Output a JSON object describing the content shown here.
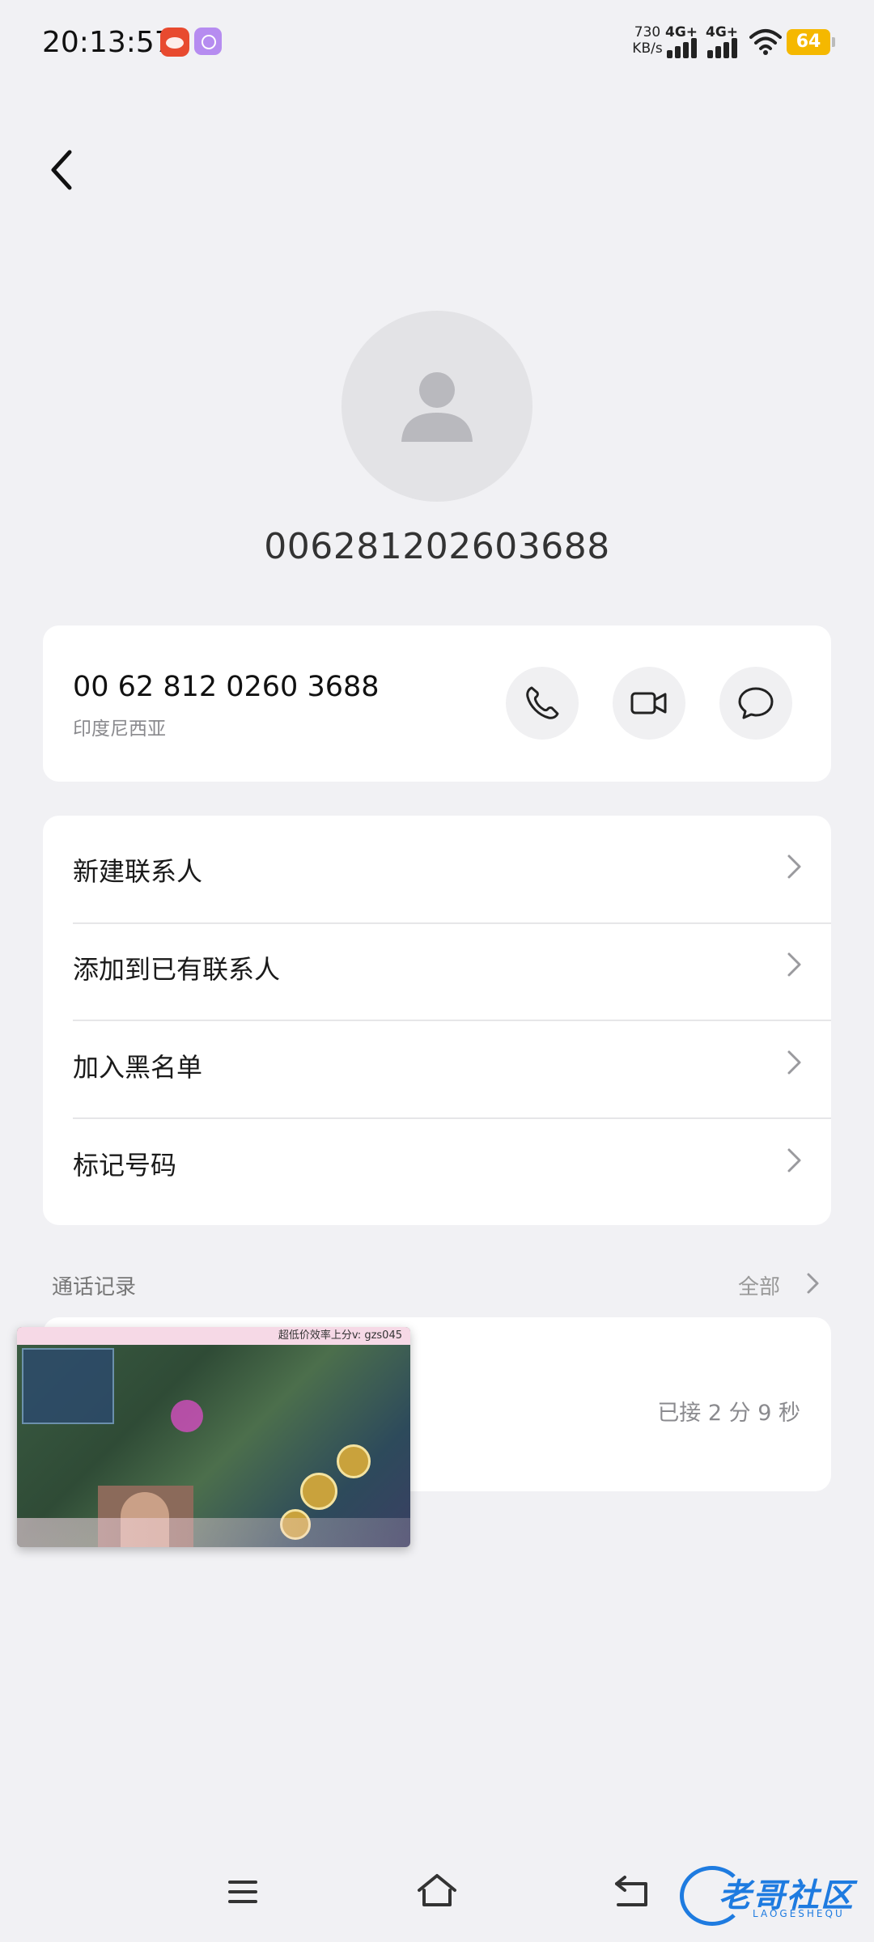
{
  "status_bar": {
    "time": "20:13:57",
    "net_speed_value": "730",
    "net_speed_unit": "KB/s",
    "sim1_label": "4G+",
    "sim2_label": "4G+",
    "battery": "64",
    "icons": [
      "app-notification-icon",
      "app-notification-icon",
      "signal-icon",
      "wifi-icon",
      "battery-icon"
    ]
  },
  "header": {
    "number_title": "006281202603688"
  },
  "phone_card": {
    "number": "00 62 812 0260 3688",
    "region": "印度尼西亚",
    "actions": [
      "phone-icon",
      "video-call-icon",
      "message-icon"
    ]
  },
  "menu": {
    "items": [
      {
        "label": "新建联系人"
      },
      {
        "label": "添加到已有联系人"
      },
      {
        "label": "加入黑名单"
      },
      {
        "label": "标记号码"
      }
    ]
  },
  "call_log": {
    "title": "通话记录",
    "all_label": "全部",
    "entry_status": "已接 2 分 9 秒"
  },
  "pip": {
    "banner_text": "超低价效率上分v: gzs045"
  },
  "watermark": {
    "text": "老哥社区",
    "sub": "LAOGESHEQU"
  },
  "colors": {
    "background": "#f1f1f4",
    "card": "#ffffff",
    "battery": "#f5b800",
    "secondary_text": "#8a8a8e"
  }
}
